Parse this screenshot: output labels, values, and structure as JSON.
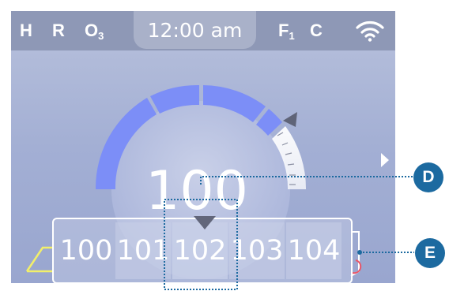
{
  "status_bar": {
    "indicators": [
      {
        "label": "H",
        "sub": ""
      },
      {
        "label": "R",
        "sub": ""
      },
      {
        "label": "O",
        "sub": "3"
      }
    ],
    "time": "12:00 am",
    "filter_indicator": {
      "label": "F",
      "sub": "1"
    },
    "cool_indicator": "C",
    "wifi_icon": "wifi-icon"
  },
  "dial": {
    "setpoint": "100",
    "accent_color": "#7c8ef7",
    "arrow_icon": "triangle-marker-icon"
  },
  "temperature_scroller": {
    "values": [
      "100",
      "101",
      "102",
      "103",
      "104"
    ],
    "selected": "102",
    "pointer_icon": "triangle-down-icon"
  },
  "next_page_icon": "chevron-right-icon",
  "callouts": [
    {
      "label": "D",
      "color": "#1c6aa0"
    },
    {
      "label": "E",
      "color": "#1c6aa0"
    }
  ]
}
